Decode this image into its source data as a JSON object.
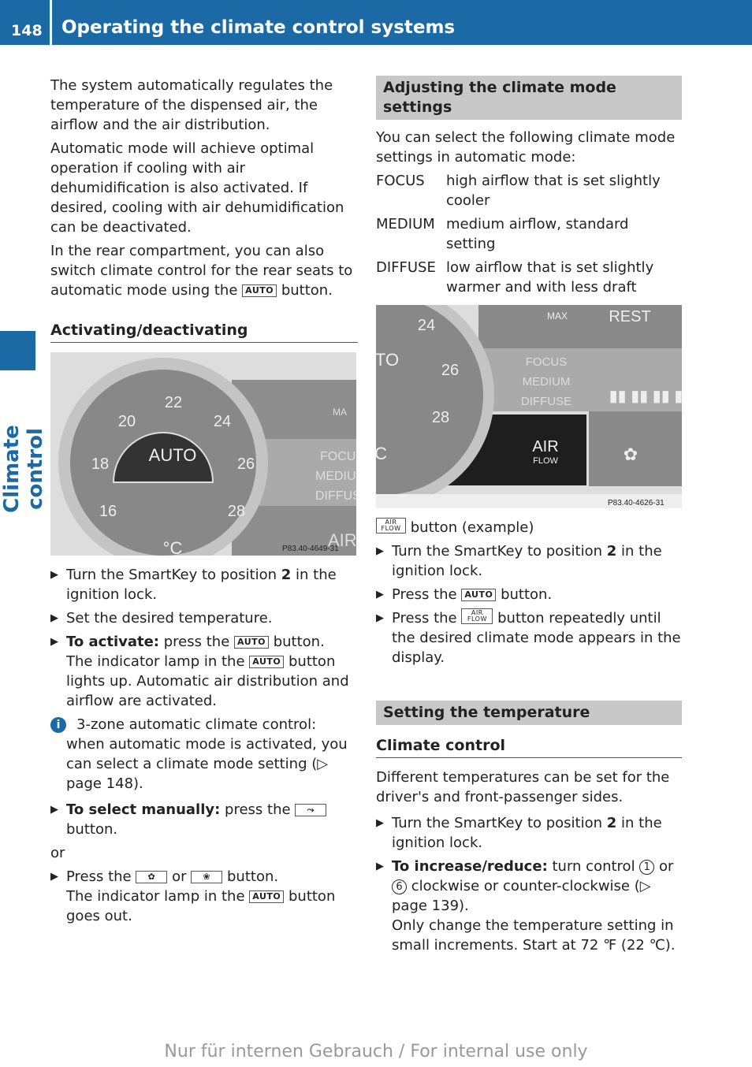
{
  "header": {
    "page_number": "148",
    "title": "Operating the climate control systems"
  },
  "side_tab": "Climate control",
  "left": {
    "intro": [
      "The system automatically regulates the temperature of the dispensed air, the airflow and the air distribution.",
      "Automatic mode will achieve optimal operation if cooling with air dehumidification is also activated. If desired, cooling with air dehumidification can be deactivated."
    ],
    "rear_a": "In the rear compartment, you can also switch climate control for the rear seats to automatic mode using the",
    "rear_b": "button.",
    "auto_key": "AUTO",
    "subheading": "Activating/deactivating",
    "figure": {
      "scale": [
        "22",
        "20",
        "24",
        "18",
        "26",
        "16",
        "28"
      ],
      "center": "AUTO",
      "unit": "°C",
      "side": [
        "FOCU",
        "MEDIU",
        "DIFFUS"
      ],
      "max": "MA",
      "air": "AIR",
      "code": "P83.40-4649-31"
    },
    "steps": {
      "s1a": "Turn the SmartKey to position",
      "s1b": "2",
      "s1c": "in the ignition lock.",
      "s2": "Set the desired temperature.",
      "s3_bold": "To activate:",
      "s3a": "press the",
      "s3b": "button.",
      "s3c": "The indicator lamp in the",
      "s3d": "button lights up. Automatic air distribution and airflow are activated."
    },
    "info": "3-zone automatic climate control: when automatic mode is activated, you can select a climate mode setting (▷ page 148).",
    "manual_bold": "To select manually:",
    "manual_a": "press the",
    "manual_b": "button.",
    "or": "or",
    "press_a": "Press the",
    "press_or": "or",
    "press_b": "button.",
    "lamp_a": "The indicator lamp in the",
    "lamp_b": "button goes out."
  },
  "right": {
    "band1": "Adjusting the climate mode settings",
    "intro": "You can select the following climate mode settings in automatic mode:",
    "modes": [
      {
        "term": "FOCUS",
        "desc": "high airflow that is set slightly cooler"
      },
      {
        "term": "MEDIUM",
        "desc": "medium airflow, standard setting"
      },
      {
        "term": "DIFFUSE",
        "desc": "low airflow that is set slightly warmer and with less draft"
      }
    ],
    "figure": {
      "scale": [
        "24",
        "26",
        "28"
      ],
      "auto_partial": "TO",
      "unit_partial": "C",
      "max": "MAX",
      "rest": "REST",
      "modes": [
        "FOCUS",
        "MEDIUM",
        "DIFFUSE"
      ],
      "air": "AIR",
      "flow": "FLOW",
      "code": "P83.40-4626-31"
    },
    "caption_key": "AIR FLOW",
    "caption": "button (example)",
    "steps": {
      "s1a": "Turn the SmartKey to position",
      "s1b": "2",
      "s1c": "in the ignition lock.",
      "s2a": "Press the",
      "s2b": "button.",
      "s3a": "Press the",
      "s3b": "button repeatedly until the desired climate mode appears in the display."
    },
    "band2": "Setting the temperature",
    "subheading": "Climate control",
    "temp_intro": "Different temperatures can be set for the driver's and front-passenger sides.",
    "t1a": "Turn the SmartKey to position",
    "t1b": "2",
    "t1c": "in the ignition lock.",
    "t2_bold": "To increase/reduce:",
    "t2a": "turn control",
    "c1": "1",
    "t2b": "or",
    "c6": "6",
    "t2c": "clockwise or counter-clockwise (▷ page 139).",
    "t2d": "Only change the temperature setting in small increments. Start at 72 ℉ (22 ℃)."
  },
  "footer": "Nur für internen Gebrauch / For internal use only",
  "colors": {
    "brand_blue": "#1b6aa5",
    "band_gray": "#c8c8c8"
  }
}
